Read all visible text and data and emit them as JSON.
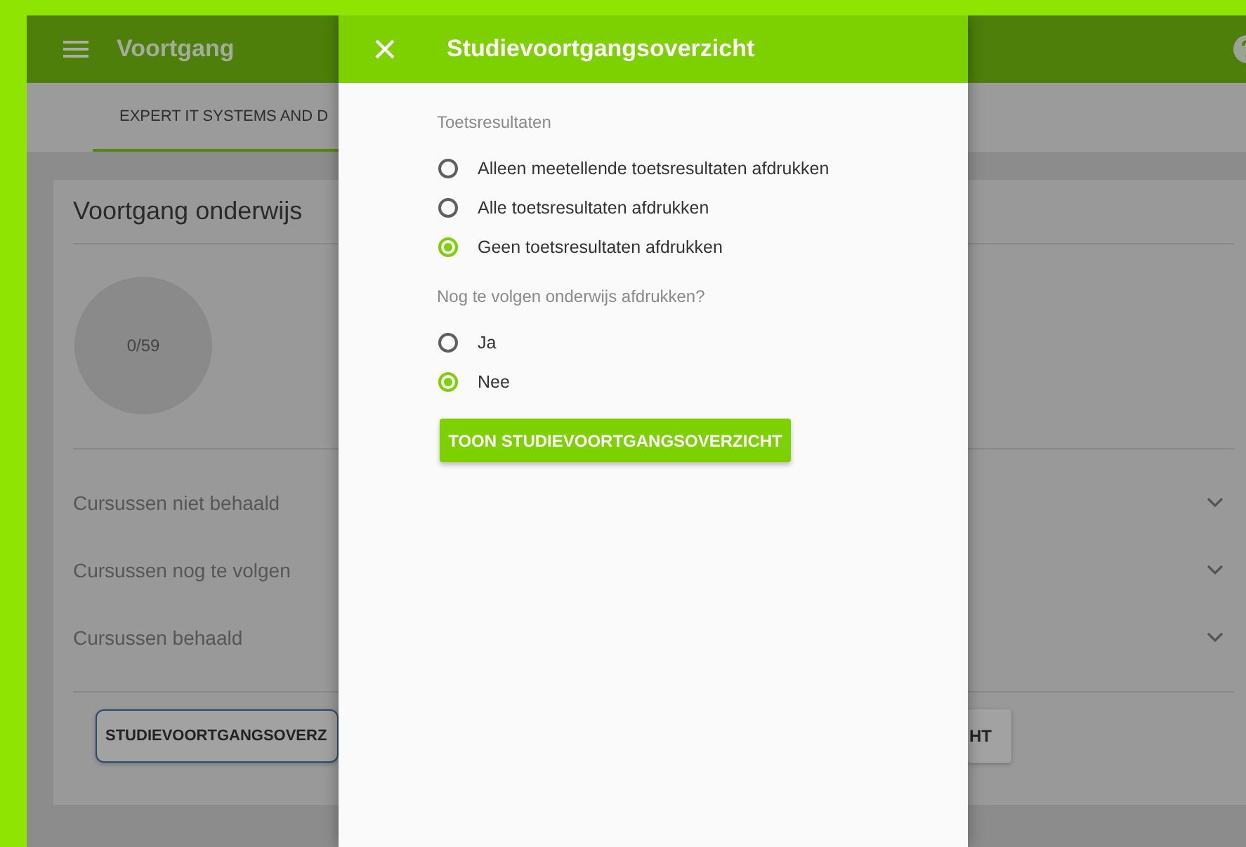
{
  "app_bar": {
    "title": "Voortgang"
  },
  "tabs": [
    {
      "label": "EXPERT IT SYSTEMS AND D",
      "selected": true
    }
  ],
  "card": {
    "title": "Voortgang onderwijs",
    "progress": {
      "text": "0/59"
    },
    "sections": [
      {
        "label": "Cursussen niet behaald",
        "expanded": false
      },
      {
        "label": "Cursussen nog te volgen",
        "expanded": false
      },
      {
        "label": "Cursussen behaald",
        "expanded": false
      }
    ],
    "buttons": [
      {
        "label": "STUDIEVOORTGANGSOVERZ",
        "focused": true
      },
      {
        "label": "HT",
        "focused": false
      }
    ]
  },
  "dialog": {
    "title": "Studievoortgangsoverzicht",
    "groups": [
      {
        "label": "Toetsresultaten",
        "options": [
          {
            "label": "Alleen meetellende toetsresultaten afdrukken",
            "selected": false
          },
          {
            "label": "Alle toetsresultaten afdrukken",
            "selected": false
          },
          {
            "label": "Geen toetsresultaten afdrukken",
            "selected": true
          }
        ]
      },
      {
        "label": "Nog te volgen onderwijs afdrukken?",
        "options": [
          {
            "label": "Ja",
            "selected": false
          },
          {
            "label": "Nee",
            "selected": true
          }
        ]
      }
    ],
    "button": "TOON STUDIEVOORTGANGSOVERZICHT"
  }
}
